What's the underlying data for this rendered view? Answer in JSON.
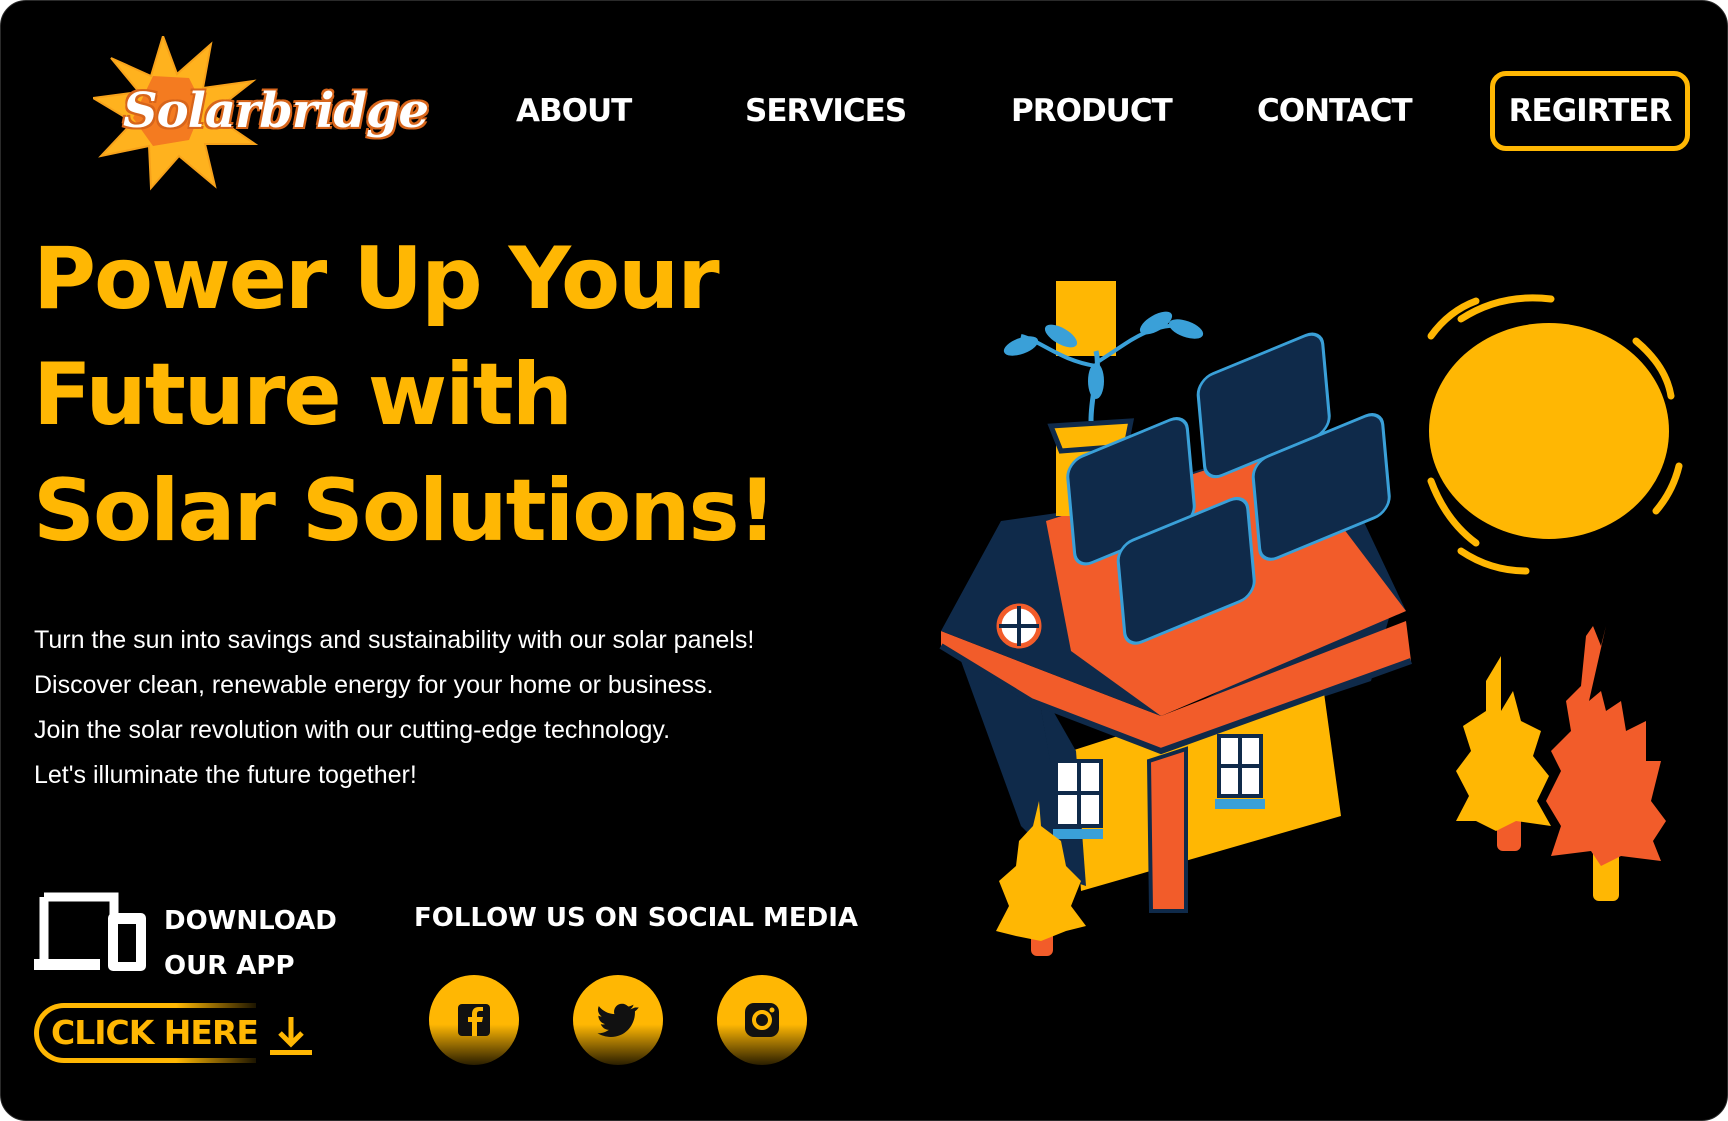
{
  "brand": {
    "logo_text": "Solarbridge"
  },
  "nav": {
    "items": [
      {
        "label": "ABOUT"
      },
      {
        "label": "SERVICES"
      },
      {
        "label": "PRODUCT"
      },
      {
        "label": "CONTACT"
      }
    ],
    "register_label": "REGIRTER"
  },
  "hero": {
    "headline_lines": [
      "Power Up Your",
      "Future with",
      "Solar Solutions!"
    ],
    "description_lines": [
      "Turn the sun into savings and sustainability with our solar panels!",
      "Discover clean, renewable energy for your home or business.",
      "Join the solar revolution with our cutting-edge technology.",
      "Let's illuminate the future together!"
    ]
  },
  "download": {
    "label_lines": [
      "DOWNLOAD",
      "OUR APP"
    ],
    "button_label": "CLICK HERE",
    "icon": "devices-icon"
  },
  "social": {
    "title": "FOLLOW US ON SOCIAL MEDIA",
    "icons": [
      "facebook-icon",
      "twitter-icon",
      "instagram-icon"
    ]
  },
  "colors": {
    "background": "#000000",
    "accent": "#ffb703",
    "roof": "#f25c2a",
    "navy": "#0f2a4a",
    "panel_line": "#3aa0d8",
    "text": "#ffffff"
  }
}
